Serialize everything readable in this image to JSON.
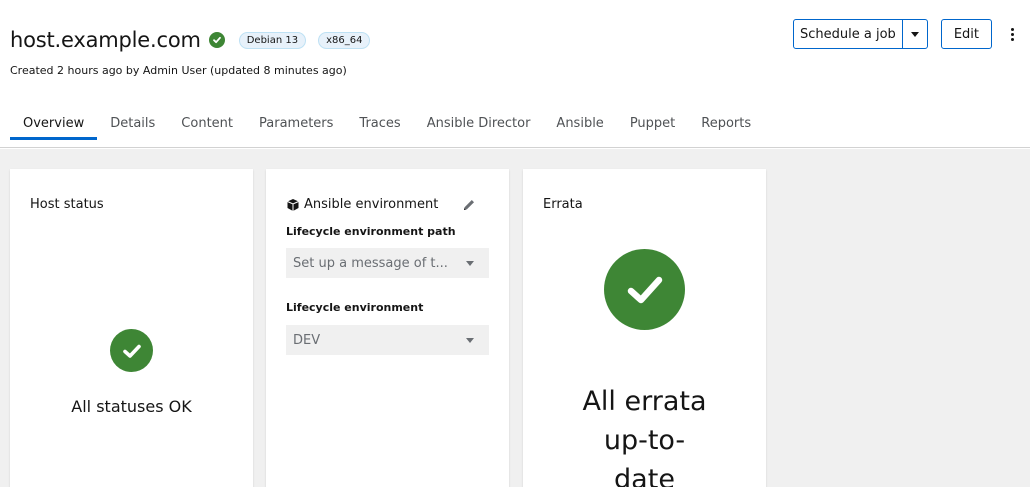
{
  "host": {
    "name": "host.example.com",
    "badges": [
      "Debian 13",
      "x86_64"
    ],
    "subtitle": "Created 2 hours ago by Admin User (updated 8 minutes ago)"
  },
  "actions": {
    "schedule_label": "Schedule a job",
    "edit_label": "Edit"
  },
  "tabs": [
    {
      "label": "Overview",
      "active": true
    },
    {
      "label": "Details"
    },
    {
      "label": "Content"
    },
    {
      "label": "Parameters"
    },
    {
      "label": "Traces"
    },
    {
      "label": "Ansible Director"
    },
    {
      "label": "Ansible"
    },
    {
      "label": "Puppet"
    },
    {
      "label": "Reports"
    }
  ],
  "cards": {
    "host_status": {
      "title": "Host status",
      "status_text": "All statuses OK"
    },
    "ansible_env": {
      "title": "Ansible environment",
      "path_label": "Lifecycle environment path",
      "path_value": "Set up a message of t...",
      "env_label": "Lifecycle environment",
      "env_value": "DEV"
    },
    "errata": {
      "title": "Errata",
      "line1": "All errata",
      "line2": "up-to-",
      "line3": "date"
    }
  },
  "colors": {
    "accent": "#06c",
    "success": "#3e8635",
    "page_bg": "#f0f0f0"
  }
}
